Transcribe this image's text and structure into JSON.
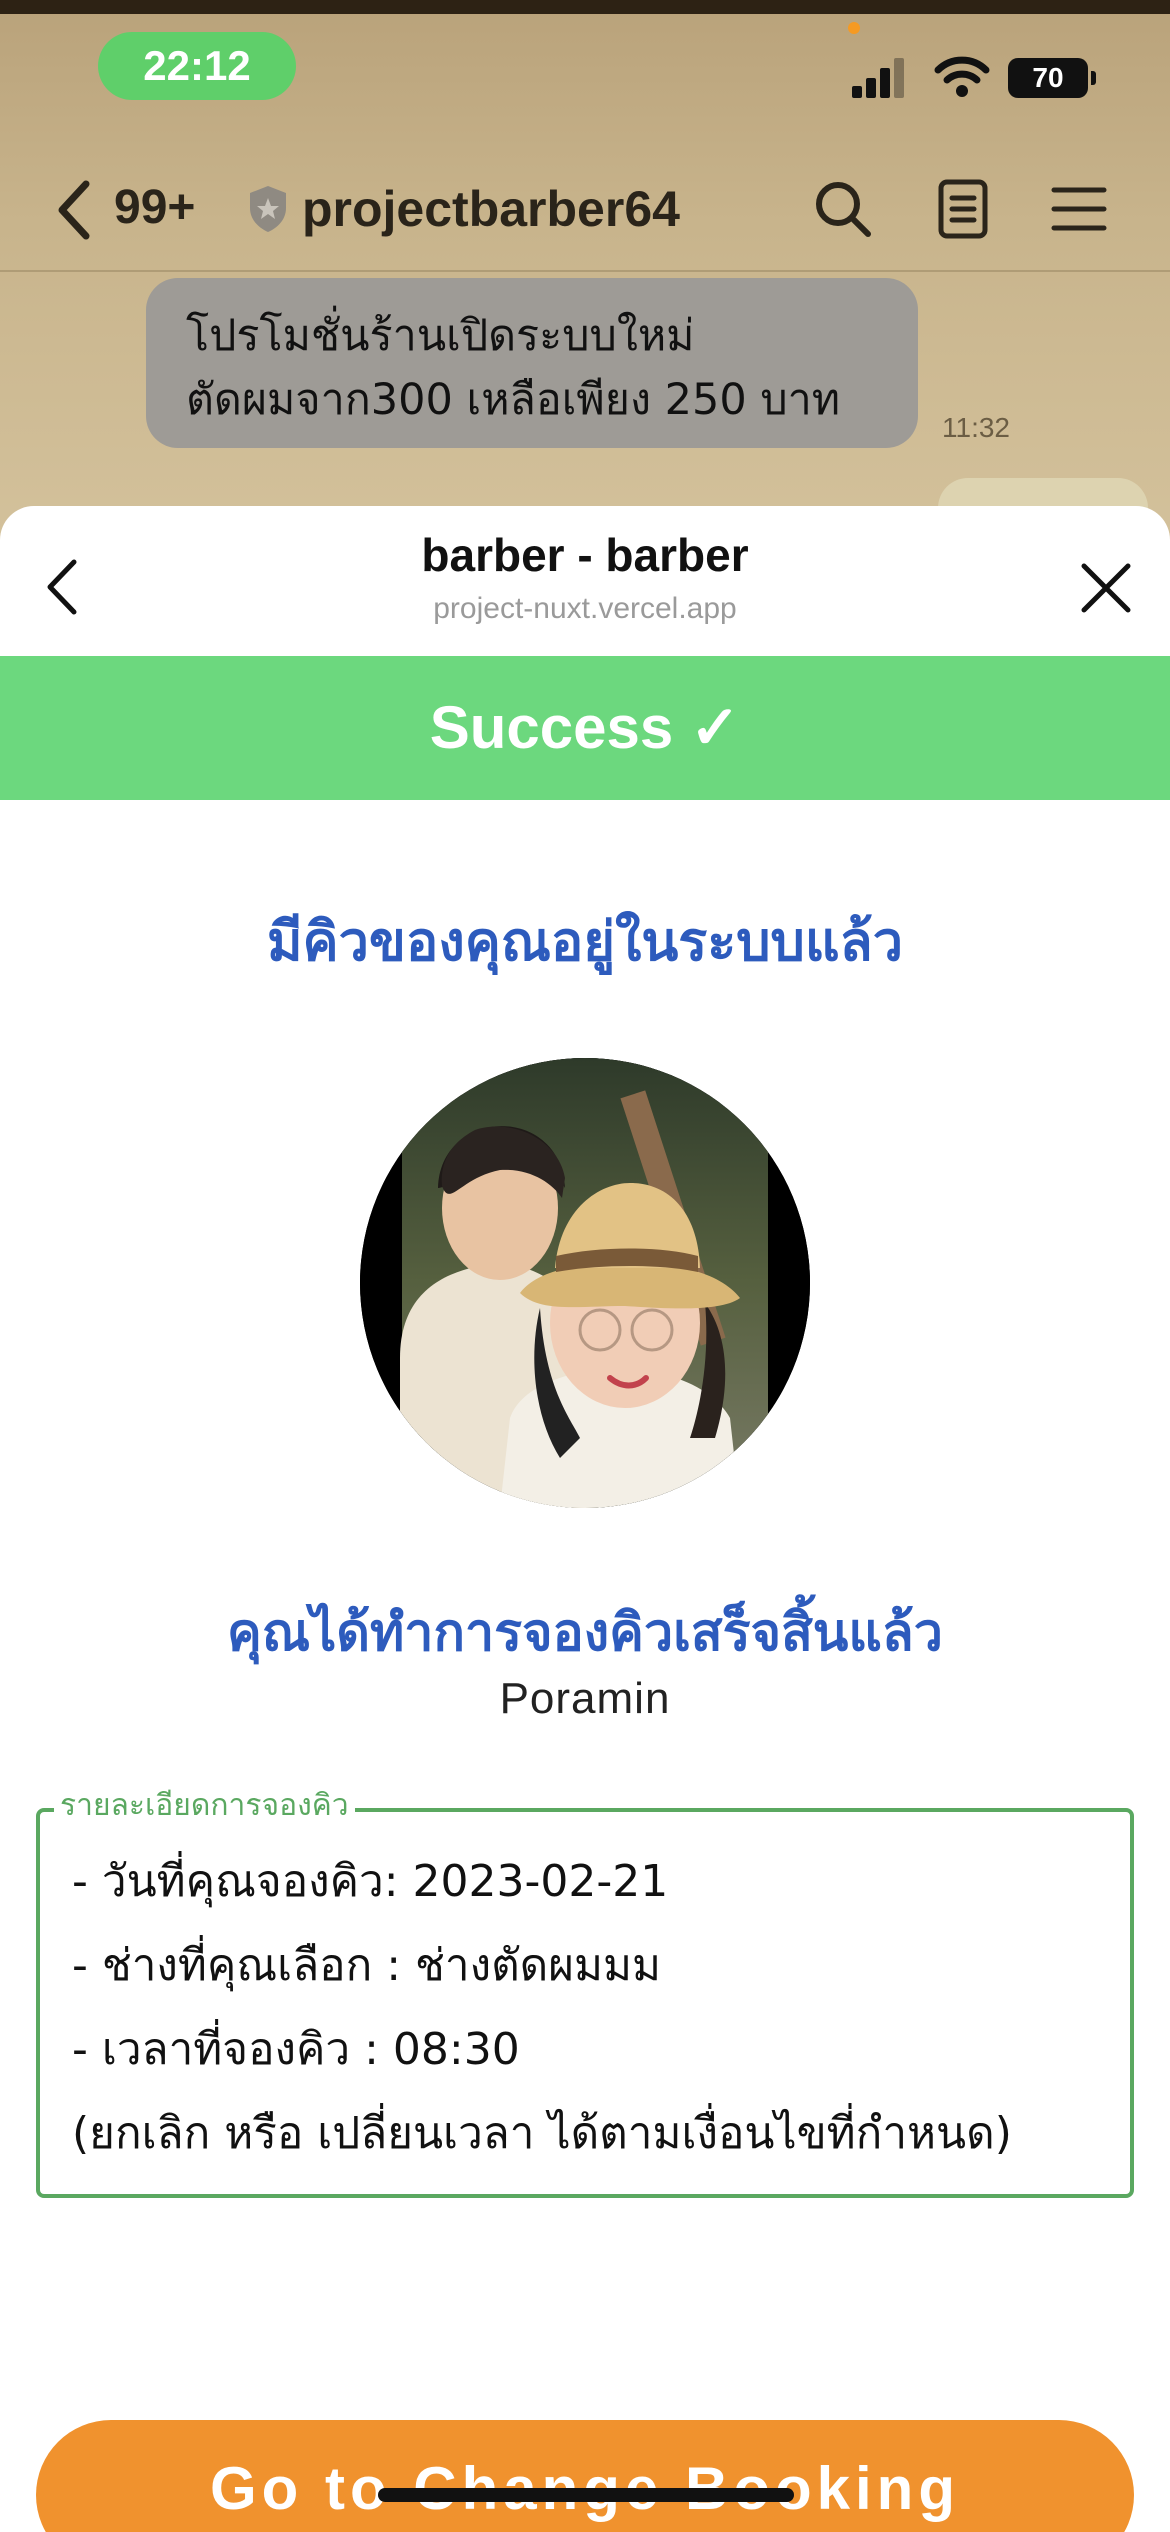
{
  "status_bar": {
    "time": "22:12",
    "battery": "70"
  },
  "chat": {
    "unread_count": "99+",
    "name": "projectbarber64",
    "message_lines": [
      "โปรโมชั่นร้านเปิดระบบใหม่",
      "ตัดผมจาก300 เหลือเพียง 250 บาท"
    ],
    "message_time": "11:32"
  },
  "sheet": {
    "title": "barber - barber",
    "url": "project-nuxt.vercel.app"
  },
  "page": {
    "success_label": "Success ✓",
    "headline": "มีคิวของคุณอยู่ในระบบแล้ว",
    "subheadline": "คุณได้ทำการจองคิวเสร็จสิ้นแล้ว",
    "person_name": "Poramin",
    "details": {
      "legend": "รายละเอียดการจองคิว",
      "lines": [
        "- วันที่คุณจองคิว: 2023-02-21",
        "- ช่างที่คุณเลือก : ช่างตัดผมมม",
        "- เวลาที่จองคิว : 08:30",
        "(ยกเลิก หรือ เปลี่ยนเวลา ได้ตามเงื่อนไขที่กำหนด)"
      ]
    },
    "change_button": "Go to Change Booking"
  },
  "colors": {
    "success": "#6cd87e",
    "headline": "#2d5bbd",
    "details_border": "#5aa860",
    "button": "#f0922e",
    "status_pill": "#5fcf6a"
  },
  "icons": [
    "back-chevron-icon",
    "shield-icon",
    "search-icon",
    "notes-icon",
    "menu-icon",
    "close-icon",
    "signal-icon",
    "wifi-icon",
    "battery-icon"
  ]
}
